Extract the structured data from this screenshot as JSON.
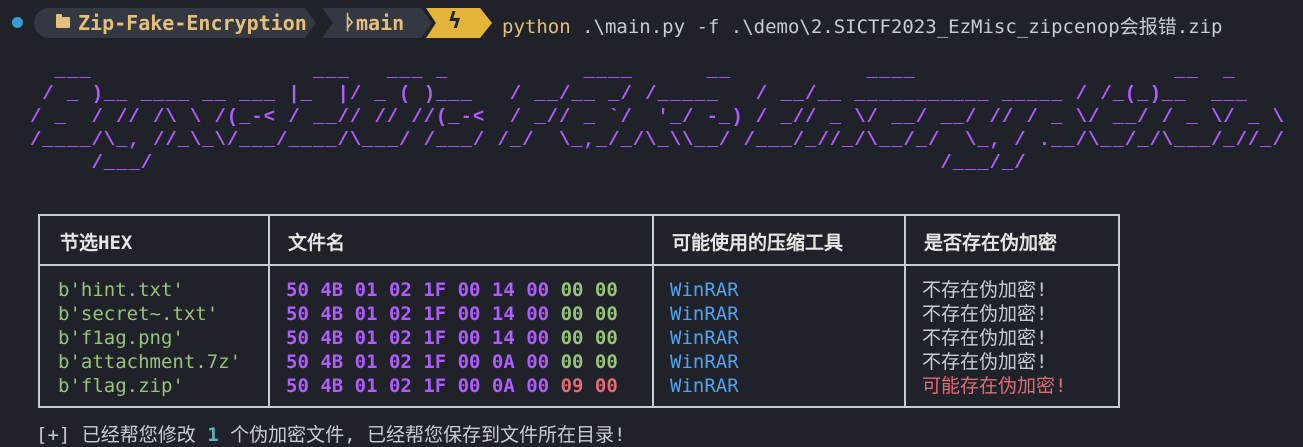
{
  "prompt": {
    "directory": "Zip-Fake-Encryption",
    "branch": "main",
    "command_program": "python",
    "command_args": " .\\main.py -f .\\demo\\2.SICTF2023_EzMisc_zipcenop会报错.zip"
  },
  "banner_ascii": "  ___                  ___   ___ _           ____      __           ____                     __  _\n / _ )__ ____ __ ___ |_  |/ _ ( )___   / __/__ _/ /_____   / __/__ ___________ _____ / /_(_)__  ___\n/ _  / // /\\ \\ /(_-< / __// // //(_-<  / _// _ `/  '_/ -_) / _// _ \\/ __/ __/ // / _ \\/ __/ / _ \\/ _ \\\n/____/\\_, //_\\_\\/___/____/\\___/ /___/ /_/  \\_,_/_/\\_\\\\__/ /___/_//_/\\__/_/  \\_, / .__/\\__/_/\\___/_//_/\n     /___/                                                                /___/_/",
  "table": {
    "headers": [
      "节选HEX",
      "文件名",
      "可能使用的压缩工具",
      "是否存在伪加密"
    ],
    "rows": [
      {
        "name": "b'hint.txt'",
        "hex_a": "50 4B 01 02 1F 00 14 00",
        "hex_b": "00 00",
        "tool": "WinRAR",
        "status": "不存在伪加密!",
        "warn": false
      },
      {
        "name": "b'secret~.txt'",
        "hex_a": "50 4B 01 02 1F 00 14 00",
        "hex_b": "00 00",
        "tool": "WinRAR",
        "status": "不存在伪加密!",
        "warn": false
      },
      {
        "name": "b'f1ag.png'",
        "hex_a": "50 4B 01 02 1F 00 14 00",
        "hex_b": "00 00",
        "tool": "WinRAR",
        "status": "不存在伪加密!",
        "warn": false
      },
      {
        "name": "b'attachment.7z'",
        "hex_a": "50 4B 01 02 1F 00 0A 00",
        "hex_b": "00 00",
        "tool": "WinRAR",
        "status": "不存在伪加密!",
        "warn": false
      },
      {
        "name": "b'flag.zip'",
        "hex_a": "50 4B 01 02 1F 00 0A 00",
        "hex_b": "09 00",
        "tool": "WinRAR",
        "status": "可能存在伪加密!",
        "warn": true
      }
    ]
  },
  "footer": {
    "prefix": "[+] 已经帮您修改 ",
    "count": "1",
    "suffix": " 个伪加密文件, 已经帮您保存到文件所在目录!"
  },
  "colors": {
    "background": "#1f2228",
    "ascii": "#b05cff",
    "accent_yellow": "#e5c07b",
    "status_warn": "#e06c75",
    "tool_blue": "#4fa3f0"
  }
}
